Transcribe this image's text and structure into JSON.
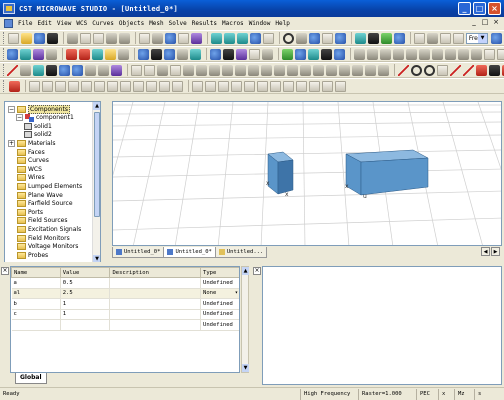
{
  "window": {
    "title": "CST MICROWAVE STUDIO - [Untitled_0*]",
    "buttons": [
      "_",
      "□",
      "×"
    ]
  },
  "menu": {
    "items": [
      "File",
      "Edit",
      "View",
      "WCS",
      "Curves",
      "Objects",
      "Mesh",
      "Solve",
      "Results",
      "Macros",
      "Window",
      "Help"
    ],
    "doc_controls": [
      "_",
      "□",
      "×"
    ]
  },
  "toolbar": {
    "mode_select": "Free"
  },
  "tree": {
    "items": [
      {
        "label": "Components",
        "level": 0,
        "expander": "−",
        "icon": "folder",
        "selected": true
      },
      {
        "label": "component1",
        "level": 1,
        "expander": "−",
        "icon": "component"
      },
      {
        "label": "solid1",
        "level": 2,
        "icon": "solid"
      },
      {
        "label": "solid2",
        "level": 2,
        "icon": "solid"
      },
      {
        "label": "Materials",
        "level": 0,
        "expander": "+",
        "icon": "folder"
      },
      {
        "label": "Faces",
        "level": 0,
        "icon": "folder"
      },
      {
        "label": "Curves",
        "level": 0,
        "icon": "folder"
      },
      {
        "label": "WCS",
        "level": 0,
        "icon": "folder"
      },
      {
        "label": "Wires",
        "level": 0,
        "icon": "folder"
      },
      {
        "label": "Lumped Elements",
        "level": 0,
        "icon": "folder"
      },
      {
        "label": "Plane Wave",
        "level": 0,
        "icon": "folder"
      },
      {
        "label": "Farfield Source",
        "level": 0,
        "icon": "folder"
      },
      {
        "label": "Ports",
        "level": 0,
        "icon": "folder"
      },
      {
        "label": "Field Sources",
        "level": 0,
        "icon": "folder"
      },
      {
        "label": "Excitation Signals",
        "level": 0,
        "icon": "folder"
      },
      {
        "label": "Field Monitors",
        "level": 0,
        "icon": "folder"
      },
      {
        "label": "Voltage Monitors",
        "level": 0,
        "icon": "folder"
      },
      {
        "label": "Probes",
        "level": 0,
        "icon": "folder"
      }
    ]
  },
  "view": {
    "tabs": [
      "Untitled_0*",
      "Untitled_0*",
      "Untitled..."
    ],
    "axis_label": "u"
  },
  "parameters": {
    "columns": [
      "Name",
      "Value",
      "Description",
      "Type"
    ],
    "rows": [
      {
        "name": "a",
        "value": "0.5",
        "description": "",
        "type": "Undefined"
      },
      {
        "name": "al",
        "value": "2.5",
        "description": "",
        "type": "None"
      },
      {
        "name": "b",
        "value": "1",
        "description": "",
        "type": "Undefined"
      },
      {
        "name": "c",
        "value": "1",
        "description": "",
        "type": "Undefined"
      },
      {
        "name": "",
        "value": "",
        "description": "",
        "type": "Undefined"
      }
    ],
    "tab": "Global"
  },
  "status": {
    "ready": "Ready",
    "frequency": "High Frequency",
    "raster": "Raster=1.000",
    "boundary": "PEC",
    "ax": "x",
    "mz": "Mz",
    "unit": "s"
  },
  "colors": {
    "titlebar": "#0a5fd8",
    "solid_face": "#5a95c9",
    "solid_top": "#8db9e0",
    "solid_side": "#3e74a8"
  }
}
